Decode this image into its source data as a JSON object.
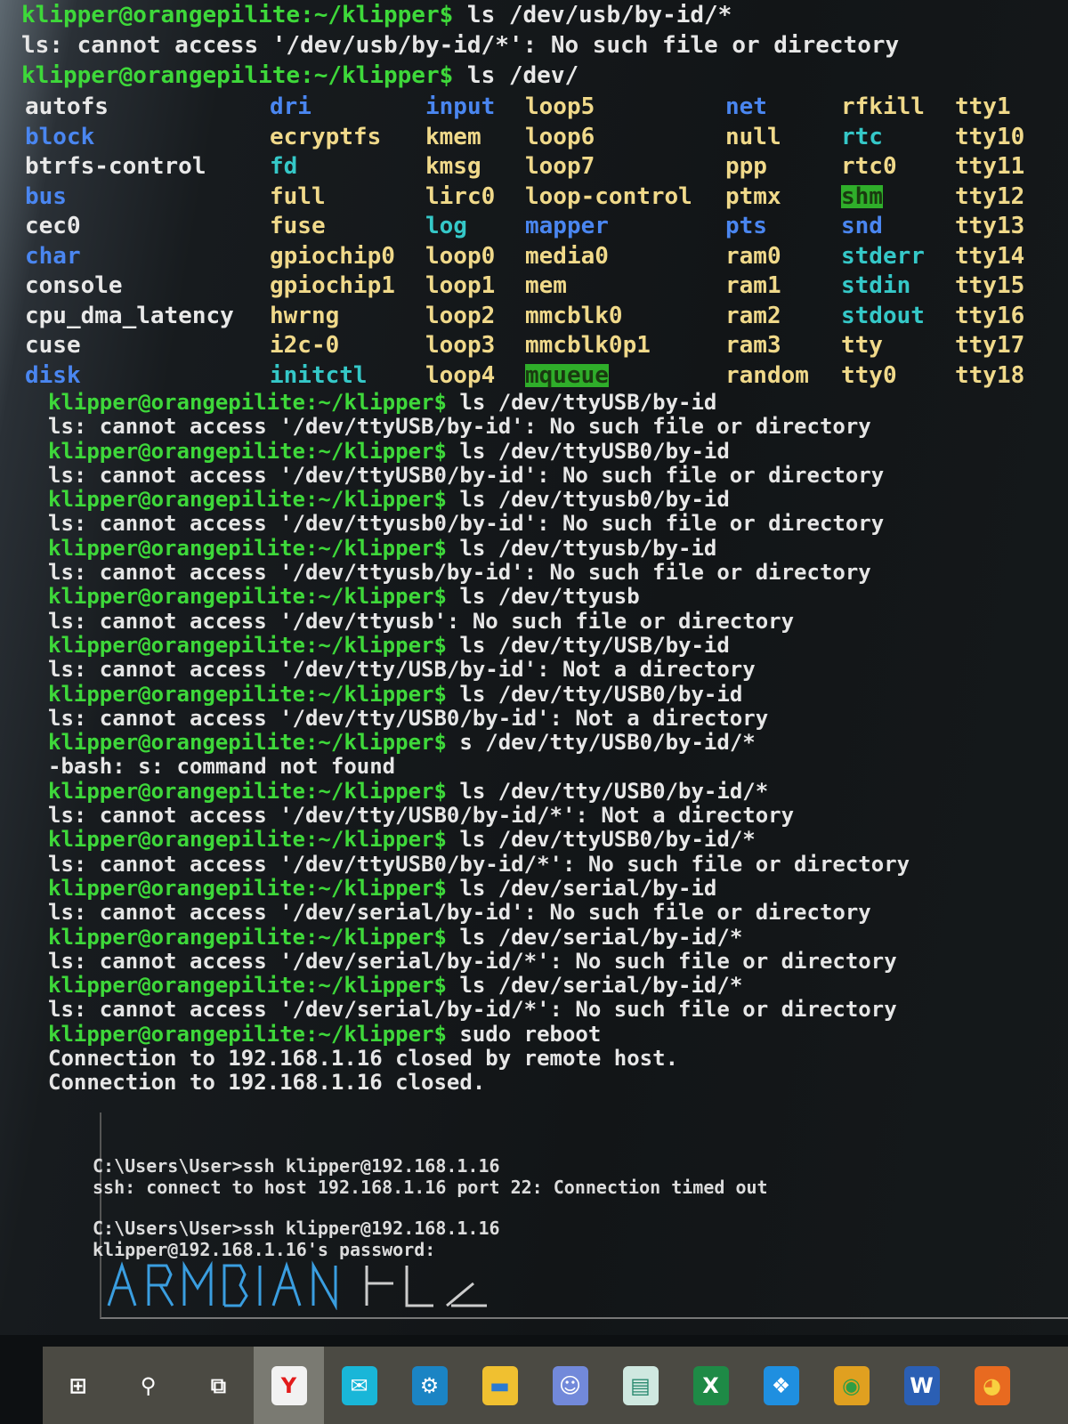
{
  "prompt": "klipper@orangepilite:~/klipper$",
  "intro": [
    {
      "type": "cmd",
      "text": "ls /dev/usb/by-id/*"
    },
    {
      "type": "out",
      "text": "ls: cannot access '/dev/usb/by-id/*': No such file or directory"
    },
    {
      "type": "cmd",
      "text": "ls /dev/"
    }
  ],
  "dev_listing": [
    [
      {
        "n": "autofs",
        "c": "w"
      },
      {
        "n": "block",
        "c": "b"
      },
      {
        "n": "btrfs-control",
        "c": "w"
      },
      {
        "n": "bus",
        "c": "b"
      },
      {
        "n": "cec0",
        "c": "w"
      },
      {
        "n": "char",
        "c": "b"
      },
      {
        "n": "console",
        "c": "w"
      },
      {
        "n": "cpu_dma_latency",
        "c": "w"
      },
      {
        "n": "cuse",
        "c": "w"
      },
      {
        "n": "disk",
        "c": "b"
      }
    ],
    [
      {
        "n": "dri",
        "c": "b"
      },
      {
        "n": "ecryptfs",
        "c": "y"
      },
      {
        "n": "fd",
        "c": "c"
      },
      {
        "n": "full",
        "c": "y"
      },
      {
        "n": "fuse",
        "c": "y"
      },
      {
        "n": "gpiochip0",
        "c": "y"
      },
      {
        "n": "gpiochip1",
        "c": "y"
      },
      {
        "n": "hwrng",
        "c": "y"
      },
      {
        "n": "i2c-0",
        "c": "y"
      },
      {
        "n": "initctl",
        "c": "c"
      }
    ],
    [
      {
        "n": "input",
        "c": "b"
      },
      {
        "n": "kmem",
        "c": "y"
      },
      {
        "n": "kmsg",
        "c": "y"
      },
      {
        "n": "lirc0",
        "c": "y"
      },
      {
        "n": "log",
        "c": "c"
      },
      {
        "n": "loop0",
        "c": "y"
      },
      {
        "n": "loop1",
        "c": "y"
      },
      {
        "n": "loop2",
        "c": "y"
      },
      {
        "n": "loop3",
        "c": "y"
      },
      {
        "n": "loop4",
        "c": "y"
      }
    ],
    [
      {
        "n": "loop5",
        "c": "y"
      },
      {
        "n": "loop6",
        "c": "y"
      },
      {
        "n": "loop7",
        "c": "y"
      },
      {
        "n": "loop-control",
        "c": "y"
      },
      {
        "n": "mapper",
        "c": "b"
      },
      {
        "n": "media0",
        "c": "y"
      },
      {
        "n": "mem",
        "c": "y"
      },
      {
        "n": "mmcblk0",
        "c": "y"
      },
      {
        "n": "mmcblk0p1",
        "c": "y"
      },
      {
        "n": "mqueue",
        "c": "g"
      }
    ],
    [
      {
        "n": "net",
        "c": "b"
      },
      {
        "n": "null",
        "c": "y"
      },
      {
        "n": "ppp",
        "c": "y"
      },
      {
        "n": "ptmx",
        "c": "y"
      },
      {
        "n": "pts",
        "c": "b"
      },
      {
        "n": "ram0",
        "c": "y"
      },
      {
        "n": "ram1",
        "c": "y"
      },
      {
        "n": "ram2",
        "c": "y"
      },
      {
        "n": "ram3",
        "c": "y"
      },
      {
        "n": "random",
        "c": "y"
      }
    ],
    [
      {
        "n": "rfkill",
        "c": "y"
      },
      {
        "n": "rtc",
        "c": "c"
      },
      {
        "n": "rtc0",
        "c": "y"
      },
      {
        "n": "shm",
        "c": "g"
      },
      {
        "n": "snd",
        "c": "b"
      },
      {
        "n": "stderr",
        "c": "c"
      },
      {
        "n": "stdin",
        "c": "c"
      },
      {
        "n": "stdout",
        "c": "c"
      },
      {
        "n": "tty",
        "c": "y"
      },
      {
        "n": "tty0",
        "c": "y"
      }
    ],
    [
      {
        "n": "tty1",
        "c": "y"
      },
      {
        "n": "tty10",
        "c": "y"
      },
      {
        "n": "tty11",
        "c": "y"
      },
      {
        "n": "tty12",
        "c": "y"
      },
      {
        "n": "tty13",
        "c": "y"
      },
      {
        "n": "tty14",
        "c": "y"
      },
      {
        "n": "tty15",
        "c": "y"
      },
      {
        "n": "tty16",
        "c": "y"
      },
      {
        "n": "tty17",
        "c": "y"
      },
      {
        "n": "tty18",
        "c": "y"
      }
    ]
  ],
  "session": [
    {
      "type": "cmd",
      "text": "ls /dev/ttyUSB/by-id"
    },
    {
      "type": "out",
      "text": "ls: cannot access '/dev/ttyUSB/by-id': No such file or directory"
    },
    {
      "type": "cmd",
      "text": "ls /dev/ttyUSB0/by-id"
    },
    {
      "type": "out",
      "text": "ls: cannot access '/dev/ttyUSB0/by-id': No such file or directory"
    },
    {
      "type": "cmd",
      "text": "ls /dev/ttyusb0/by-id"
    },
    {
      "type": "out",
      "text": "ls: cannot access '/dev/ttyusb0/by-id': No such file or directory"
    },
    {
      "type": "cmd",
      "text": "ls /dev/ttyusb/by-id"
    },
    {
      "type": "out",
      "text": "ls: cannot access '/dev/ttyusb/by-id': No such file or directory"
    },
    {
      "type": "cmd",
      "text": "ls /dev/ttyusb"
    },
    {
      "type": "out",
      "text": "ls: cannot access '/dev/ttyusb': No such file or directory"
    },
    {
      "type": "cmd",
      "text": "ls /dev/tty/USB/by-id"
    },
    {
      "type": "out",
      "text": "ls: cannot access '/dev/tty/USB/by-id': Not a directory"
    },
    {
      "type": "cmd",
      "text": "ls /dev/tty/USB0/by-id"
    },
    {
      "type": "out",
      "text": "ls: cannot access '/dev/tty/USB0/by-id': Not a directory"
    },
    {
      "type": "cmd",
      "text": "s /dev/tty/USB0/by-id/*"
    },
    {
      "type": "out",
      "text": "-bash: s: command not found"
    },
    {
      "type": "cmd",
      "text": "ls /dev/tty/USB0/by-id/*"
    },
    {
      "type": "out",
      "text": "ls: cannot access '/dev/tty/USB0/by-id/*': Not a directory"
    },
    {
      "type": "cmd",
      "text": "ls /dev/ttyUSB0/by-id/*"
    },
    {
      "type": "out",
      "text": "ls: cannot access '/dev/ttyUSB0/by-id/*': No such file or directory"
    },
    {
      "type": "cmd",
      "text": "ls /dev/serial/by-id"
    },
    {
      "type": "out",
      "text": "ls: cannot access '/dev/serial/by-id': No such file or directory"
    },
    {
      "type": "cmd",
      "text": "ls /dev/serial/by-id/*"
    },
    {
      "type": "out",
      "text": "ls: cannot access '/dev/serial/by-id/*': No such file or directory"
    },
    {
      "type": "cmd",
      "text": "ls /dev/serial/by-id/*"
    },
    {
      "type": "out",
      "text": "ls: cannot access '/dev/serial/by-id/*': No such file or directory"
    },
    {
      "type": "cmd",
      "text": "sudo reboot"
    },
    {
      "type": "out",
      "text": "Connection to 192.168.1.16 closed by remote host."
    },
    {
      "type": "out",
      "text": "Connection to 192.168.1.16 closed."
    }
  ],
  "windows": [
    {
      "type": "gap",
      "text": ""
    },
    {
      "type": "out",
      "text": "C:\\Users\\User>ssh klipper@192.168.1.16"
    },
    {
      "type": "out",
      "text": "ssh: connect to host 192.168.1.16 port 22: Connection timed out"
    },
    {
      "type": "gap",
      "text": ""
    },
    {
      "type": "out",
      "text": "C:\\Users\\User>ssh klipper@192.168.1.16"
    },
    {
      "type": "out",
      "text": "klipper@192.168.1.16's password:"
    }
  ],
  "banner_art_text": "ARMBIAN",
  "taskbar": {
    "items": [
      {
        "icon": "windows-start-icon",
        "glyph": "⊞",
        "bg": "transparent",
        "color": "#ffffff"
      },
      {
        "icon": "search-icon",
        "glyph": "⚲",
        "bg": "transparent",
        "color": "#ffffff"
      },
      {
        "icon": "task-view-icon",
        "glyph": "⧉",
        "bg": "transparent",
        "color": "#ffffff"
      },
      {
        "icon": "yandex-browser-icon",
        "glyph": "Y",
        "bg": "#f2f2f2",
        "color": "#e21b1b",
        "active": true
      },
      {
        "icon": "mail-icon",
        "glyph": "✉",
        "bg": "#19b6d8",
        "color": "#ffffff"
      },
      {
        "icon": "steam-icon",
        "glyph": "⚙",
        "bg": "#1b84c4",
        "color": "#ffffff"
      },
      {
        "icon": "file-explorer-icon",
        "glyph": "▬",
        "bg": "#f0c030",
        "color": "#2a7ad0"
      },
      {
        "icon": "discord-icon",
        "glyph": "☺",
        "bg": "#7289da",
        "color": "#ffffff"
      },
      {
        "icon": "notes-app-icon",
        "glyph": "▤",
        "bg": "#cfe8e0",
        "color": "#2a8a70"
      },
      {
        "icon": "excel-icon",
        "glyph": "X",
        "bg": "#1e8a46",
        "color": "#ffffff"
      },
      {
        "icon": "dropbox-icon",
        "glyph": "❖",
        "bg": "#1f8fe0",
        "color": "#ffffff"
      },
      {
        "icon": "chrome-icon",
        "glyph": "◉",
        "bg": "#e0a020",
        "color": "#2f9e44"
      },
      {
        "icon": "word-icon",
        "glyph": "W",
        "bg": "#2b5fb4",
        "color": "#ffffff"
      },
      {
        "icon": "firefox-icon",
        "glyph": "◕",
        "bg": "#e86a20",
        "color": "#f8d040"
      }
    ]
  }
}
